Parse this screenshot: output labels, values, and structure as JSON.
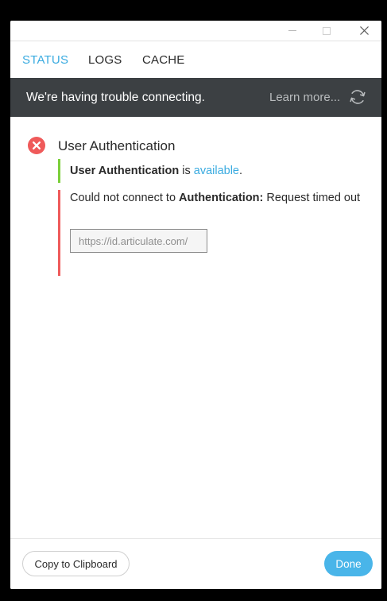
{
  "window": {
    "controls": {
      "minimize_icon": "minimize-icon",
      "maximize_icon": "maximize-icon",
      "close_icon": "close-icon"
    }
  },
  "tabs": [
    {
      "label": "STATUS",
      "active": true
    },
    {
      "label": "LOGS",
      "active": false
    },
    {
      "label": "CACHE",
      "active": false
    }
  ],
  "banner": {
    "message": "We're having trouble connecting.",
    "link_label": "Learn more...",
    "icon": "refresh-icon"
  },
  "section": {
    "title": "User Authentication",
    "status_icon": "error-icon",
    "ok_item": {
      "name": "User Authentication",
      "middle": " is ",
      "state": "available",
      "end": "."
    },
    "error_item": {
      "prefix": "Could not connect to ",
      "target": "Authentication:",
      "detail": " Request timed out",
      "url": "https://id.articulate.com/"
    }
  },
  "footer": {
    "copy_label": "Copy to Clipboard",
    "done_label": "Done"
  },
  "colors": {
    "accent": "#3aabe0",
    "banner_bg": "#3c4043",
    "success": "#7bcf3a",
    "error": "#ef5a5a",
    "done_button": "#49b5e9"
  }
}
